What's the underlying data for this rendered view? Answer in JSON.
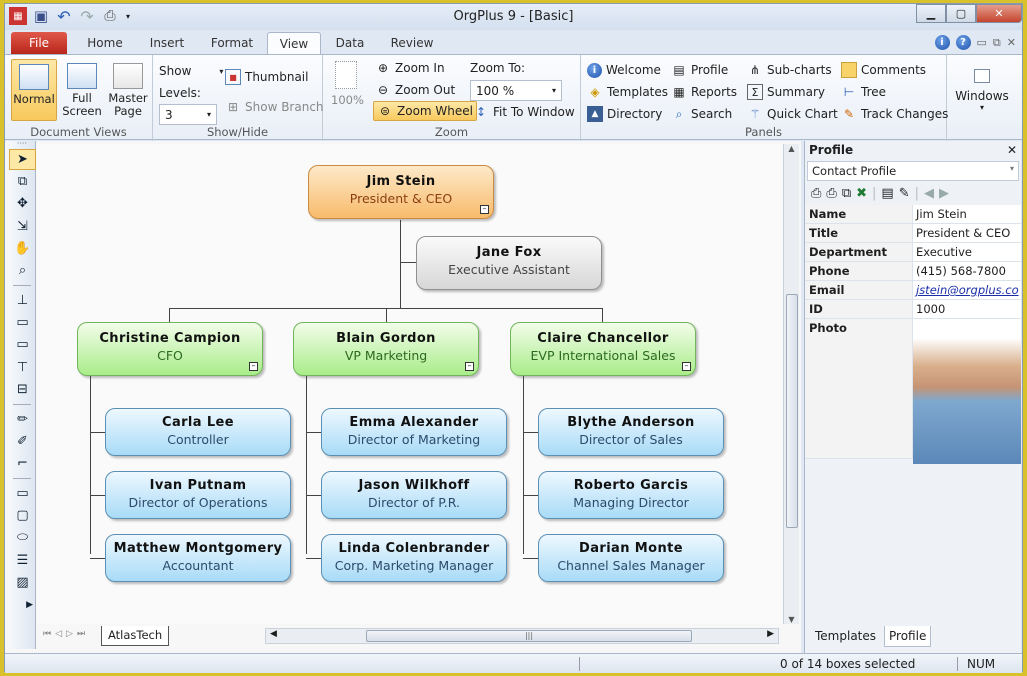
{
  "window": {
    "title": "OrgPlus 9 - [Basic]"
  },
  "ribbon_tabs": [
    {
      "label": "File"
    },
    {
      "label": "Home"
    },
    {
      "label": "Insert"
    },
    {
      "label": "Format"
    },
    {
      "label": "View"
    },
    {
      "label": "Data"
    },
    {
      "label": "Review"
    }
  ],
  "active_tab": "View",
  "groups": {
    "document_views": {
      "label": "Document Views",
      "buttons": [
        "Normal",
        "Full Screen",
        "Master Page"
      ]
    },
    "show_hide": {
      "label": "Show/Hide",
      "show": "Show",
      "levels_label": "Levels:",
      "levels_value": "3",
      "thumbnail": "Thumbnail",
      "show_branch": "Show Branch"
    },
    "zoom": {
      "label": "Zoom",
      "percent": "100%",
      "zoom_in": "Zoom In",
      "zoom_out": "Zoom Out",
      "zoom_wheel": "Zoom Wheel",
      "zoom_to_label": "Zoom To:",
      "zoom_to_value": "100 %",
      "fit_to_window": "Fit To Window"
    },
    "panels": {
      "label": "Panels",
      "items": [
        "Welcome",
        "Templates",
        "Directory",
        "Profile",
        "Reports",
        "Search",
        "Sub-charts",
        "Summary",
        "Quick Chart",
        "Comments",
        "Tree",
        "Track Changes"
      ]
    },
    "windows": {
      "label": "Windows"
    }
  },
  "chart": {
    "root": {
      "name": "Jim Stein",
      "title": "President & CEO"
    },
    "assistant": {
      "name": "Jane Fox",
      "title": "Executive Assistant"
    },
    "branches": [
      {
        "name": "Christine  Campion",
        "title": "CFO",
        "reports": [
          {
            "name": "Carla  Lee",
            "title": "Controller"
          },
          {
            "name": "Ivan  Putnam",
            "title": "Director of Operations"
          },
          {
            "name": "Matthew  Montgomery",
            "title": "Accountant"
          }
        ]
      },
      {
        "name": "Blain Gordon",
        "title": "VP Marketing",
        "reports": [
          {
            "name": "Emma  Alexander",
            "title": "Director of Marketing"
          },
          {
            "name": "Jason  Wilkhoff",
            "title": "Director of P.R."
          },
          {
            "name": "Linda  Colenbrander",
            "title": "Corp. Marketing Manager"
          }
        ]
      },
      {
        "name": "Claire  Chancellor",
        "title": "EVP International Sales",
        "reports": [
          {
            "name": "Blythe  Anderson",
            "title": "Director of  Sales"
          },
          {
            "name": "Roberto  Garcis",
            "title": "Managing Director"
          },
          {
            "name": "Darian  Monte",
            "title": "Channel Sales Manager"
          }
        ]
      }
    ]
  },
  "sheet_tab": "AtlasTech",
  "profile": {
    "title": "Profile",
    "view": "Contact Profile",
    "fields": [
      {
        "k": "Name",
        "v": "Jim Stein"
      },
      {
        "k": "Title",
        "v": "President & CEO"
      },
      {
        "k": "Department",
        "v": "Executive"
      },
      {
        "k": "Phone",
        "v": "(415) 568-7800"
      },
      {
        "k": "Email",
        "v": "jstein@orgplus.co"
      },
      {
        "k": "ID",
        "v": "1000"
      },
      {
        "k": "Photo",
        "v": ""
      }
    ],
    "tabs": [
      "Templates",
      "Profile"
    ]
  },
  "status": {
    "selection": "0 of 14 boxes selected",
    "num": "NUM"
  }
}
